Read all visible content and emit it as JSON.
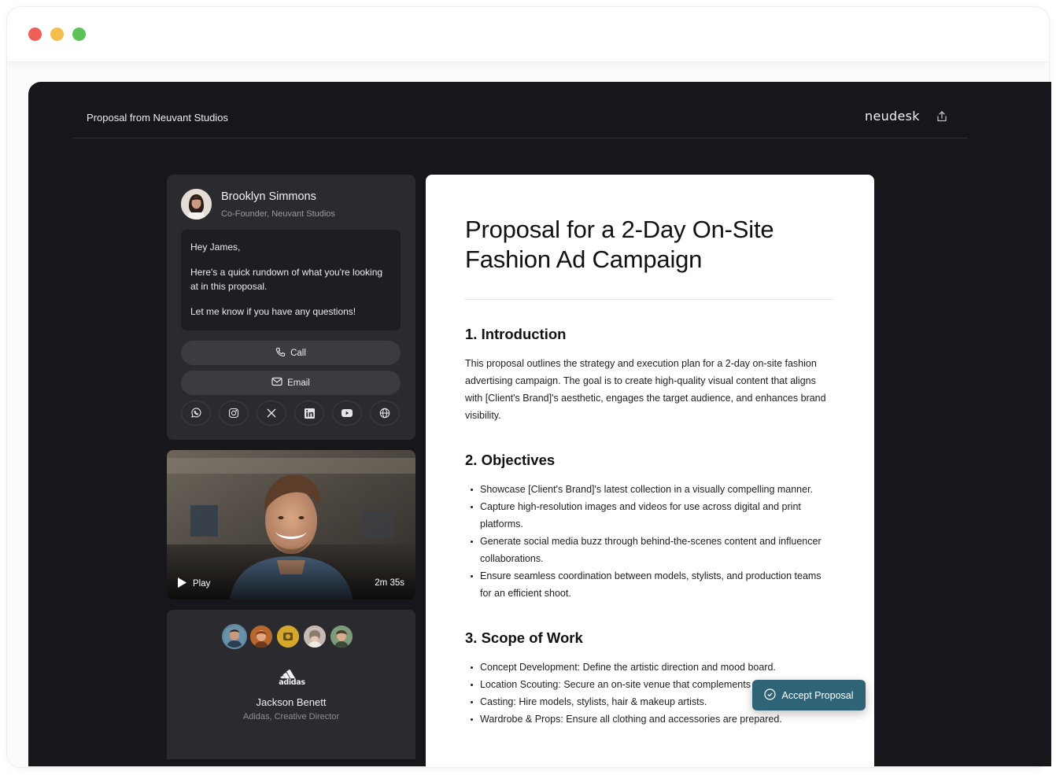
{
  "header": {
    "title": "Proposal from Neuvant Studios",
    "brand": "neudesk"
  },
  "sender": {
    "name": "Brooklyn Simmons",
    "role": "Co-Founder, Neuvant Studios",
    "message": [
      "Hey James,",
      "Here's a quick rundown of what you're looking at in this proposal.",
      "Let me know if you have any questions!"
    ],
    "call_label": "Call",
    "email_label": "Email",
    "socials": [
      "whatsapp-icon",
      "instagram-icon",
      "x-icon",
      "linkedin-icon",
      "youtube-icon",
      "globe-icon"
    ]
  },
  "video": {
    "play_label": "Play",
    "duration": "2m 35s"
  },
  "client": {
    "name": "Jackson Benett",
    "role": "Adidas, Creative Director",
    "logo": "adidas"
  },
  "doc": {
    "title": "Proposal for a 2-Day On-Site Fashion Ad Campaign",
    "sections": [
      {
        "heading": "1. Introduction",
        "paragraph": "This proposal outlines the strategy and execution plan for a 2-day on-site fashion advertising campaign. The goal is to create high-quality visual content that aligns with [Client's Brand]'s aesthetic, engages the target audience, and enhances brand visibility."
      },
      {
        "heading": "2. Objectives",
        "bullets": [
          "Showcase [Client's Brand]'s latest collection in a visually compelling manner.",
          "Capture high-resolution images and videos for use across digital and print platforms.",
          "Generate social media buzz through behind-the-scenes content and influencer collaborations.",
          "Ensure seamless coordination between models, stylists, and production teams for an efficient shoot."
        ]
      },
      {
        "heading": "3. Scope of Work",
        "bullets": [
          "Concept Development: Define the artistic direction and mood board.",
          "Location Scouting: Secure an on-site venue that complements the brand.",
          "Casting: Hire models, stylists, hair & makeup artists.",
          "Wardrobe & Props: Ensure all clothing and accessories are prepared."
        ]
      }
    ],
    "accept_label": "Accept Proposal"
  },
  "colors": {
    "app_bg": "#17171b",
    "card_bg": "#2a2a2f",
    "accent": "#2f6476"
  }
}
